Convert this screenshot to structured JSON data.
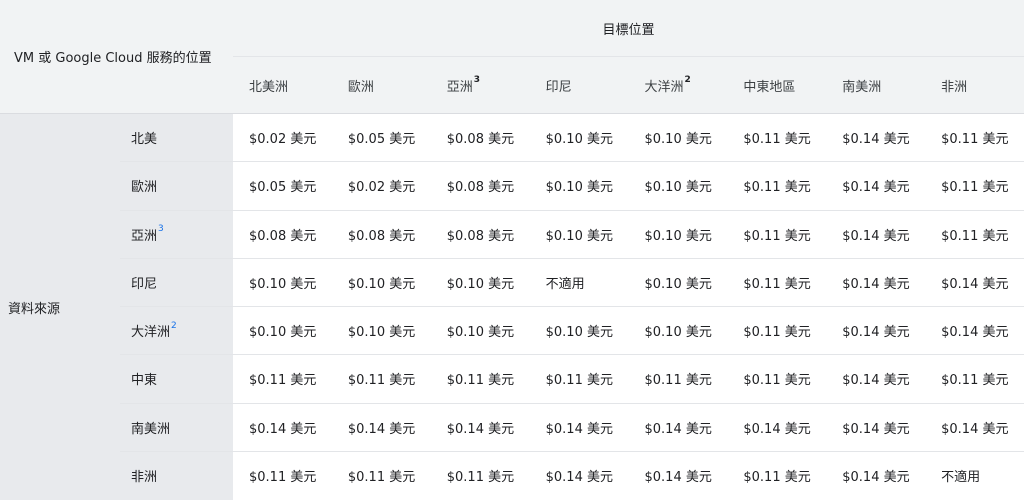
{
  "table": {
    "vm_header": "VM 或 Google Cloud 服務的位置",
    "destination_title": "目標位置",
    "source_label": "資料來源",
    "columns": [
      {
        "label": "北美洲",
        "sup": ""
      },
      {
        "label": "歐洲",
        "sup": ""
      },
      {
        "label": "亞洲",
        "sup": "3"
      },
      {
        "label": "印尼",
        "sup": ""
      },
      {
        "label": "大洋洲",
        "sup": "2"
      },
      {
        "label": "中東地區",
        "sup": ""
      },
      {
        "label": "南美洲",
        "sup": ""
      },
      {
        "label": "非洲",
        "sup": ""
      }
    ],
    "rows": [
      {
        "label": "北美",
        "sup": "",
        "values": [
          "$0.02 美元",
          "$0.05 美元",
          "$0.08 美元",
          "$0.10 美元",
          "$0.10 美元",
          "$0.11 美元",
          "$0.14 美元",
          "$0.11 美元"
        ]
      },
      {
        "label": "歐洲",
        "sup": "",
        "values": [
          "$0.05 美元",
          "$0.02 美元",
          "$0.08 美元",
          "$0.10 美元",
          "$0.10 美元",
          "$0.11 美元",
          "$0.14 美元",
          "$0.11 美元"
        ]
      },
      {
        "label": "亞洲",
        "sup": "3",
        "values": [
          "$0.08 美元",
          "$0.08 美元",
          "$0.08 美元",
          "$0.10 美元",
          "$0.10 美元",
          "$0.11 美元",
          "$0.14 美元",
          "$0.11 美元"
        ]
      },
      {
        "label": "印尼",
        "sup": "",
        "values": [
          "$0.10 美元",
          "$0.10 美元",
          "$0.10 美元",
          "不適用",
          "$0.10 美元",
          "$0.11 美元",
          "$0.14 美元",
          "$0.14 美元"
        ]
      },
      {
        "label": "大洋洲",
        "sup": "2",
        "values": [
          "$0.10 美元",
          "$0.10 美元",
          "$0.10 美元",
          "$0.10 美元",
          "$0.10 美元",
          "$0.11 美元",
          "$0.14 美元",
          "$0.14 美元"
        ]
      },
      {
        "label": "中東",
        "sup": "",
        "values": [
          "$0.11 美元",
          "$0.11 美元",
          "$0.11 美元",
          "$0.11 美元",
          "$0.11 美元",
          "$0.11 美元",
          "$0.14 美元",
          "$0.11 美元"
        ]
      },
      {
        "label": "南美洲",
        "sup": "",
        "values": [
          "$0.14 美元",
          "$0.14 美元",
          "$0.14 美元",
          "$0.14 美元",
          "$0.14 美元",
          "$0.14 美元",
          "$0.14 美元",
          "$0.14 美元"
        ]
      },
      {
        "label": "非洲",
        "sup": "",
        "values": [
          "$0.11 美元",
          "$0.11 美元",
          "$0.11 美元",
          "$0.14 美元",
          "$0.14 美元",
          "$0.11 美元",
          "$0.14 美元",
          "不適用"
        ]
      }
    ]
  }
}
